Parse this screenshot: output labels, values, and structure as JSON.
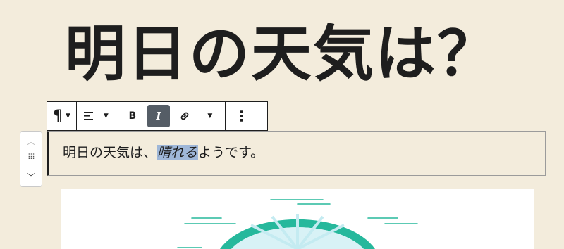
{
  "title": "明日の天気は？",
  "paragraph": {
    "before": "明日の天気は、",
    "highlight": "晴れる",
    "after": "ようです。"
  },
  "toolbar": {
    "paragraph_icon": "¶",
    "bold_label": "B",
    "italic_label": "I",
    "more_icon": "⋮"
  },
  "colors": {
    "background": "#f3ecdc",
    "accent": "#26b89c",
    "highlight": "#9fb7d8",
    "active_button": "#555d66"
  },
  "icons": [
    "paragraph-icon",
    "align-icon",
    "bold-icon",
    "italic-icon",
    "link-icon",
    "more-options-icon",
    "drag-handle-icon",
    "move-up-icon",
    "move-down-icon"
  ]
}
